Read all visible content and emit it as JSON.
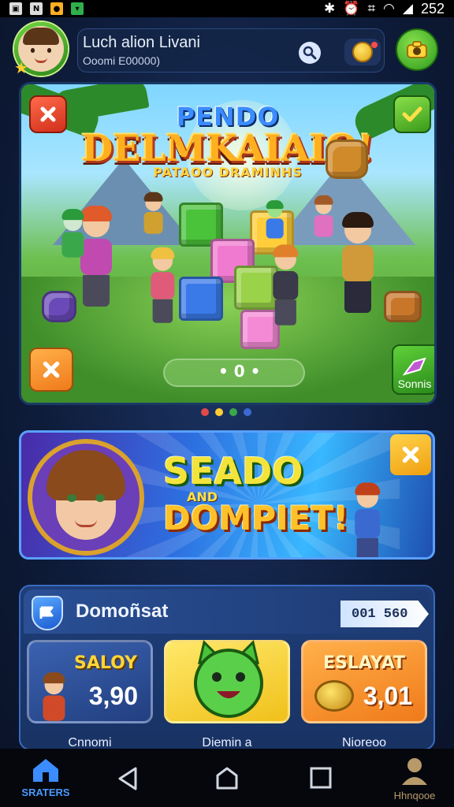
{
  "status_bar": {
    "time": "252",
    "icons": [
      "gallery-icon",
      "n-icon",
      "play-icon",
      "bag-icon"
    ],
    "system_icons": [
      "bluetooth-icon",
      "alarm-icon",
      "vibrate-icon",
      "wifi-icon",
      "signal-icon"
    ]
  },
  "header": {
    "profile_name": "Luch alion Livani",
    "profile_sub": "Ooomi E00000)"
  },
  "hero": {
    "title_top": "PENDO",
    "title_main": "DELMKAIAIO!",
    "title_sub": "PATAOO DRAMINHS",
    "dots_text": "• 0 •",
    "corner_button_label": "Sonnis"
  },
  "pager": {
    "colors": [
      "#e04a4a",
      "#ffcc33",
      "#3aa84a",
      "#3a6ad0"
    ]
  },
  "promo": {
    "title_line1": "SEADO",
    "title_and": "AND",
    "title_line2": "DOMPIET!"
  },
  "rewards": {
    "title": "Domoñsat",
    "header_value": "001 560",
    "cards": [
      {
        "title": "SALOY",
        "value": "3,90",
        "caption": "Cnnomi",
        "color": "#2a4f9a"
      },
      {
        "title": "",
        "value": "",
        "caption": "Diemin a",
        "color": "#f5d43a"
      },
      {
        "title": "ESLAYAT",
        "value": "3,01",
        "caption": "Nioreoo",
        "color": "#f59a1a"
      }
    ]
  },
  "bottom_nav": {
    "home_label": "SRATERS",
    "profile_label": "Hhnqooe"
  }
}
